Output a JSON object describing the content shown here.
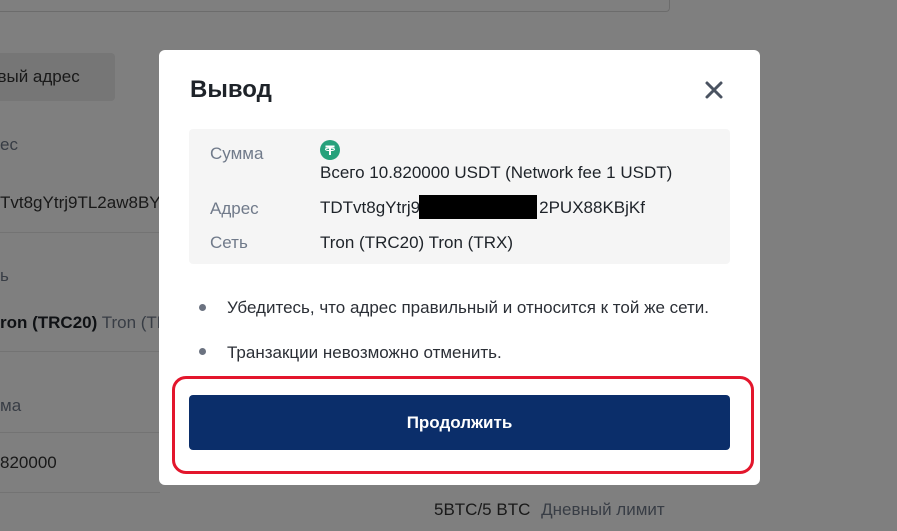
{
  "background": {
    "new_address_label": "овый адрес",
    "address_label": "ес",
    "address_value": "Tvt8gYtrj9TL2aw8BY",
    "network_label": "ь",
    "network_bold": "ron (TRC20)",
    "network_grey": "Tron (TR",
    "amount_label": "ма",
    "amount_value": "820000",
    "limit_value": "5BTC/5 BTC",
    "limit_label": "Дневный лимит"
  },
  "modal": {
    "title": "Вывод",
    "details": {
      "amount_label": "Сумма",
      "amount_value": "Всего 10.820000 USDT (Network fee 1 USDT)",
      "address_label": "Адрес",
      "address_prefix": "TDTvt8gYtrj9",
      "address_suffix": "2PUX88KBjKf",
      "network_label": "Сеть",
      "network_value": "Tron (TRC20) Tron (TRX)"
    },
    "notes": [
      "Убедитесь, что адрес правильный и относится к той же сети.",
      "Транзакции невозможно отменить."
    ],
    "continue_label": "Продолжить"
  },
  "colors": {
    "primary_button": "#0b2e6a",
    "highlight": "#e3162c",
    "tether": "#26a17b"
  }
}
